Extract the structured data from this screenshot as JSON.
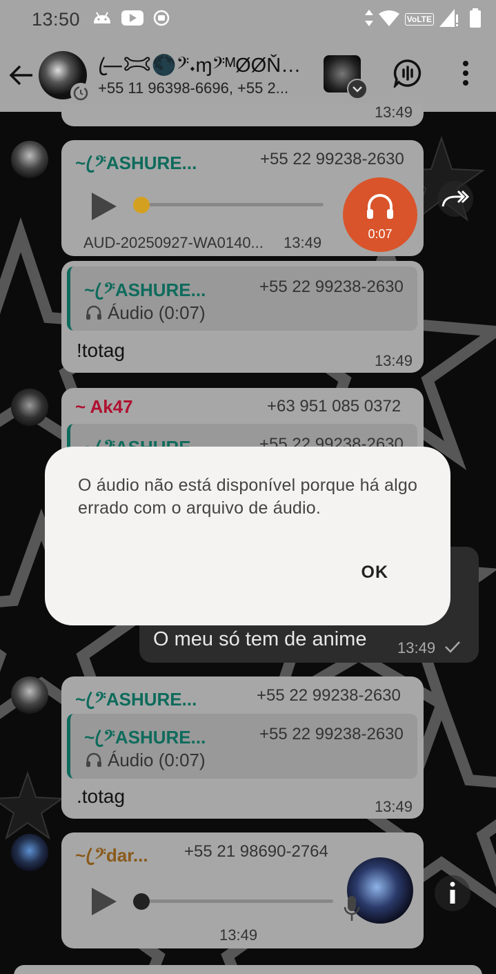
{
  "status_bar": {
    "time": "13:50",
    "network": "VoLTE"
  },
  "header": {
    "title": "—ꦿ𐂯🌑𝄢𝆺ɱ𝄢ᴹØØŇŁł...",
    "subtitle": "+55 11 96398-6696, +55 2..."
  },
  "messages": [
    {
      "prev_time": "13:49"
    },
    {
      "sender": "~ ꦿ𝄢ASHURE...",
      "sender_color": "#0e6b5c",
      "phone": "+55 22 99238-2630",
      "audio_file": "AUD-20250927-WA0140...",
      "time": "13:49",
      "audio_duration": "0:07"
    },
    {
      "quote_sender": "~ ꦿ𝄢ASHURE...",
      "quote_phone": "+55 22 99238-2630",
      "quote_text": "Áudio (0:07)",
      "text": "!totag",
      "time": "13:49"
    },
    {
      "sender": "~ Ak47",
      "sender_color": "#b01030",
      "phone": "+63 951 085 0372",
      "quote_sender": "~ ꦿ𝄢ASHURE...",
      "quote_phone": "+55 22 99238-2630"
    },
    {
      "text": "O meu só tem de anime",
      "time": "13:49"
    },
    {
      "sender": "~ ꦿ𝄢ASHURE...",
      "phone": "+55 22 99238-2630",
      "quote_sender": "~ ꦿ𝄢ASHURE...",
      "quote_phone": "+55 22 99238-2630",
      "quote_text": "Áudio (0:07)",
      "text": ".totag",
      "time": "13:49"
    },
    {
      "sender": "~ ꦿ𝄢dar...",
      "sender_color": "#8a5a1a",
      "phone": "+55 21 98690-2764",
      "time": "13:49"
    }
  ],
  "dialog": {
    "message": "O áudio não está disponível porque há algo errado com o arquivo de áudio.",
    "ok_label": "OK"
  },
  "colors": {
    "chrome": "#a5a5a5",
    "bubble_in": "#a7a7a7",
    "bubble_out": "#2c2c2c",
    "audio_orange": "#d9542b",
    "sender_green": "#0e6b5c"
  }
}
